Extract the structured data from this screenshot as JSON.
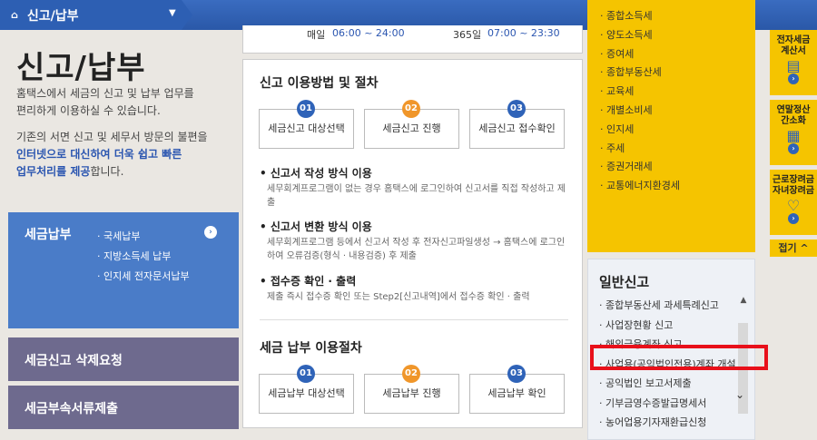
{
  "breadcrumb": {
    "home_icon": "home-icon",
    "label": "신고/납부"
  },
  "page": {
    "title": "신고/납부",
    "desc1": [
      "홈택스에서 세금의 신고 및 납부 업무를",
      "편리하게 이용하실 수 있습니다."
    ],
    "desc2_line1": "기존의 서면 신고 및 세무서 방문의 불편을",
    "desc2_line2_blue": "인터넷으로 대신하여 더욱 쉽고 빠른",
    "desc2_line3_blue": "업무처리를 제공",
    "desc2_line3_rest": "합니다."
  },
  "side_panels": {
    "tax_payment": {
      "title": "세금납부",
      "items": [
        "· 국세납부",
        "· 지방소득세 납부",
        "· 인지세 전자문서납부"
      ]
    },
    "delete_request": "세금신고 삭제요청",
    "attach_docs": "세금부속서류제출"
  },
  "hours": {
    "daily_label": "매일",
    "daily_value": "06:00 ~ 24:00",
    "year_label": "365일",
    "year_value": "07:00 ~ 23:30"
  },
  "report_section": {
    "title": "신고 이용방법 및 절차",
    "steps": [
      {
        "num": "01",
        "label": "세금신고 대상선택"
      },
      {
        "num": "02",
        "label": "세금신고 진행"
      },
      {
        "num": "03",
        "label": "세금신고 접수확인"
      }
    ],
    "bullets": [
      {
        "head": "신고서 작성 방식 이용",
        "text": "세무회계프로그램이 없는 경우 홈택스에 로그인하여 신고서를 직접 작성하고 제출"
      },
      {
        "head": "신고서 변환 방식 이용",
        "text": "세무회계프로그램 등에서 신고서 작성 후 전자신고파일생성 → 홈택스에 로그인하여 오류검증(형식 · 내용검증) 후 제출"
      },
      {
        "head": "접수증 확인 · 출력",
        "text": "제출 즉시 접수증 확인 또는 Step2[신고내역]에서 접수증 확인 · 출력"
      }
    ]
  },
  "payment_section": {
    "title": "세금 납부 이용절차",
    "steps": [
      {
        "num": "01",
        "label": "세금납부 대상선택"
      },
      {
        "num": "02",
        "label": "세금납부 진행"
      },
      {
        "num": "03",
        "label": "세금납부 확인"
      }
    ]
  },
  "tax_types": [
    "· 종합소득세",
    "· 양도소득세",
    "· 증여세",
    "· 종합부동산세",
    "· 교육세",
    "· 개별소비세",
    "· 인지세",
    "· 주세",
    "· 증권거래세",
    "· 교통에너지환경세"
  ],
  "general_report": {
    "title": "일반신고",
    "items": [
      "· 종합부동산세 과세특례신고",
      "· 사업장현황 신고",
      "· 해외금융계좌 신고",
      "· 사업용(공익법인전용)계좌 개설",
      "· 공익법인 보고서제출",
      "· 기부금영수증발급명세서",
      "· 농어업용기자재환급신청"
    ]
  },
  "right_bar": {
    "cards": [
      {
        "label": "전자세금\n계산서",
        "icon": "invoice-icon"
      },
      {
        "label": "연말정산\n간소화",
        "icon": "calculator-icon"
      },
      {
        "label": "근로장려금\n자녀장려금",
        "icon": "heart-icon"
      }
    ],
    "collapse_label": "접기 ^"
  },
  "colors": {
    "topbar": "#2d5fb3",
    "yellow": "#f5c400",
    "highlight": "#e8101a"
  }
}
